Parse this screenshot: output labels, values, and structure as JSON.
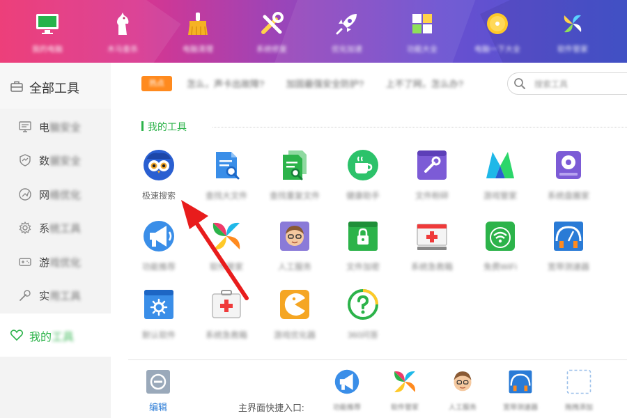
{
  "topnav": {
    "items": [
      {
        "label": "我的电脑",
        "icon": "monitor-icon",
        "color": "#27b34b"
      },
      {
        "label": "木马查杀",
        "icon": "horse-icon",
        "color": "#ffffff"
      },
      {
        "label": "电脑清理",
        "icon": "broom-icon",
        "color": "#f5b223"
      },
      {
        "label": "系统修复",
        "icon": "tools-icon",
        "color": "#ffd34a"
      },
      {
        "label": "优化加速",
        "icon": "rocket-icon",
        "color": "#ffffff"
      },
      {
        "label": "功能大全",
        "icon": "grid-apps-icon",
        "color": "#ffffff"
      },
      {
        "label": "电脑一下大全",
        "icon": "coin-icon",
        "color": "#ffc928"
      },
      {
        "label": "软件管家",
        "icon": "flower-icon",
        "color": "#ffffff"
      }
    ]
  },
  "sidebar": {
    "header_label": "全部工具",
    "items": [
      {
        "visible": "电",
        "blurred": "脑安全",
        "icon": "monitor-outline-icon"
      },
      {
        "visible": "数",
        "blurred": "据安全",
        "icon": "shield-outline-icon"
      },
      {
        "visible": "网",
        "blurred": "络优化",
        "icon": "network-outline-icon"
      },
      {
        "visible": "系",
        "blurred": "统工具",
        "icon": "gear-outline-icon"
      },
      {
        "visible": "游",
        "blurred": "戏优化",
        "icon": "gamepad-outline-icon"
      },
      {
        "visible": "实",
        "blurred": "用工具",
        "icon": "wrench-outline-icon"
      }
    ],
    "active": {
      "visible": "我的",
      "blurred": "工具",
      "icon": "heart-outline-icon"
    }
  },
  "ticker": {
    "badge": "热点",
    "items": [
      "怎么，声卡出故障?",
      "加固最强安全防护?",
      "上不了网，怎么办?"
    ]
  },
  "search": {
    "placeholder": "搜索工具"
  },
  "section": {
    "title": "我的工具"
  },
  "tools": [
    {
      "label": "极速搜索",
      "icon": "owl-search-icon",
      "blurred": false
    },
    {
      "label": "查找大文件",
      "icon": "doc-search-icon",
      "blurred": true
    },
    {
      "label": "查找重复文件",
      "icon": "duplicate-file-icon",
      "blurred": true
    },
    {
      "label": "健康助手",
      "icon": "cup-icon",
      "blurred": true
    },
    {
      "label": "文件粉碎",
      "icon": "toolbox-icon",
      "blurred": true
    },
    {
      "label": "游戏管家",
      "icon": "m-logo-icon",
      "blurred": true
    },
    {
      "label": "系统盘搬家",
      "icon": "disk-icon",
      "blurred": true
    },
    {
      "label": "功能推荐",
      "icon": "megaphone-icon",
      "blurred": true
    },
    {
      "label": "软件管家",
      "icon": "flower-icon",
      "blurred": true
    },
    {
      "label": "人工服务",
      "icon": "person-glasses-icon",
      "blurred": true
    },
    {
      "label": "文件加密",
      "icon": "lock-folder-icon",
      "blurred": true
    },
    {
      "label": "系统急救箱",
      "icon": "first-aid-icon",
      "blurred": true
    },
    {
      "label": "免费WiFi",
      "icon": "wifi-icon",
      "blurred": true
    },
    {
      "label": "宽带测速器",
      "icon": "speedometer-icon",
      "blurred": true
    },
    {
      "label": "默认软件",
      "icon": "settings-window-icon",
      "blurred": true
    },
    {
      "label": "系统急救箱",
      "icon": "medical-kit-icon",
      "blurred": true
    },
    {
      "label": "游戏优化器",
      "icon": "pacman-icon",
      "blurred": true
    },
    {
      "label": "360问答",
      "icon": "question-icon",
      "blurred": true
    }
  ],
  "bottom": {
    "edit_label": "编辑",
    "quick_label": "主界面快捷入口:",
    "quick_items": [
      {
        "label": "功能推荐",
        "icon": "megaphone-icon"
      },
      {
        "label": "软件管家",
        "icon": "flower-icon"
      },
      {
        "label": "人工服务",
        "icon": "person-glasses-icon"
      },
      {
        "label": "宽带测速器",
        "icon": "speedometer-icon"
      },
      {
        "label": "拖拽添加",
        "icon": "dashed-add-icon"
      }
    ]
  },
  "colors": {
    "accent": "#2cb34a",
    "link": "#2a7bd6",
    "arrow": "#e81c1c",
    "badge": "#ff8a1e"
  }
}
